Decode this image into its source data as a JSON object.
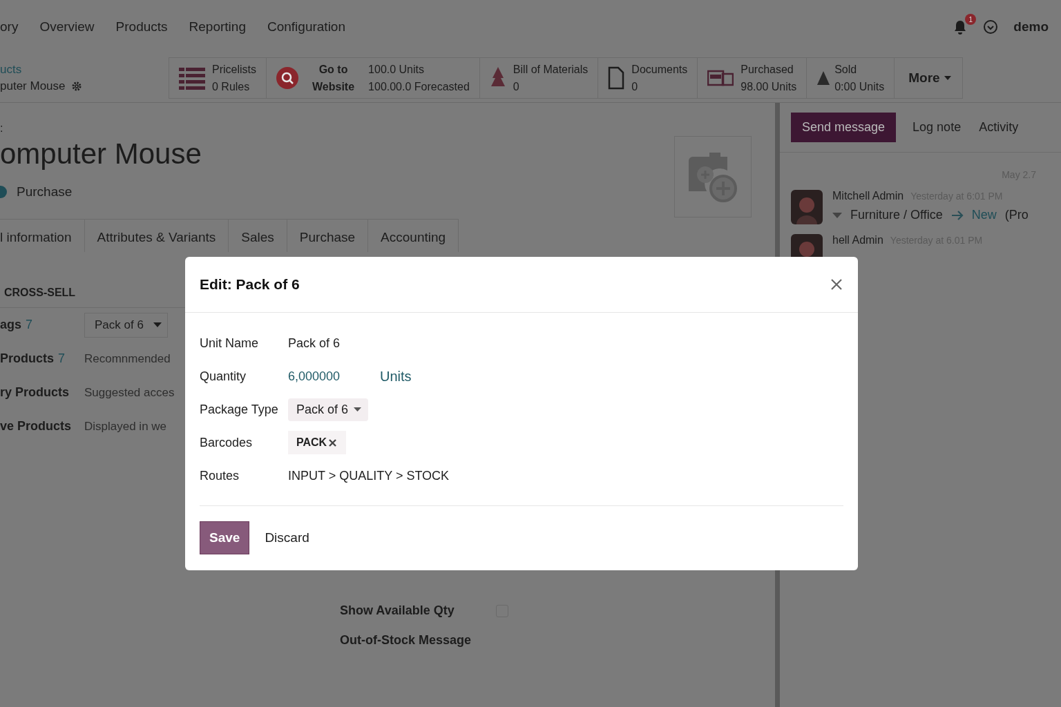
{
  "nav": {
    "menus": [
      {
        "label": "ory"
      },
      {
        "label": "Overview"
      },
      {
        "label": "Products"
      },
      {
        "label": "Reporting"
      },
      {
        "label": "Configuration"
      }
    ],
    "notification_count": "1",
    "user": "demo"
  },
  "breadcrumb": {
    "parent": "ucts",
    "current": "puter Mouse"
  },
  "smart_buttons": [
    {
      "kind": "list",
      "lines": [
        "Pricelists",
        "0 Rules"
      ]
    },
    {
      "kind": "website",
      "lines": [
        "Go to",
        "Website"
      ],
      "extra_lines": [
        "100.0 Units",
        "100.00.0 Forecasted"
      ]
    },
    {
      "kind": "tree",
      "lines": [
        "Bill of Materials",
        "0"
      ]
    },
    {
      "kind": "doc",
      "lines": [
        "Documents",
        "0"
      ]
    },
    {
      "kind": "cards",
      "lines": [
        "Purchased",
        "98.00 Units"
      ]
    },
    {
      "kind": "triangle",
      "lines": [
        "Sold",
        "0:00  Units"
      ]
    },
    {
      "kind": "more",
      "lines": [
        "More"
      ]
    }
  ],
  "product": {
    "overline": ":",
    "name": "omputer Mouse",
    "option": "Purchase"
  },
  "tabs": [
    {
      "label": "l information",
      "selected": false
    },
    {
      "label": "Attributes & Variants",
      "selected": false
    },
    {
      "label": "Sales",
      "selected": false
    },
    {
      "label": "Purchase",
      "selected": false
    },
    {
      "label": "Accounting",
      "selected": false
    }
  ],
  "section": {
    "title": "CROSS-SELL",
    "fields": [
      {
        "kind": "select",
        "label": "ags",
        "count": "7",
        "value": "Pack of 6"
      },
      {
        "kind": "text",
        "label": "Products",
        "count": "7",
        "placeholder": "Recomnmended"
      },
      {
        "kind": "text",
        "label": "ry Products",
        "placeholder": "Suggested acces"
      },
      {
        "kind": "text",
        "label": "ve Products",
        "placeholder": "Displayed in we"
      }
    ]
  },
  "lower_fields": [
    {
      "kind": "checkbox",
      "label": "Show  Available Qty",
      "checked": false
    },
    {
      "kind": "label",
      "label": "Out-of-Stock Message"
    }
  ],
  "chatter": {
    "buttons": [
      {
        "label": "Send message",
        "kind": "primary"
      },
      {
        "label": "Log note",
        "kind": "plain"
      },
      {
        "label": "Activity",
        "kind": "plain"
      }
    ],
    "date": "May 2.7",
    "messages": [
      {
        "author": "Mitchell Admin",
        "time": "Yesterday at 6:01 PM",
        "tracking": {
          "from": "Furniture / Office",
          "to": "New",
          "extra": "(Pro"
        }
      },
      {
        "author": "hell Admin",
        "time": "Yesterday at 6.01 PM"
      }
    ]
  },
  "dialog": {
    "title": "Edit: Pack of 6",
    "fields": [
      {
        "kind": "text",
        "label": "Unit Name",
        "value": "Pack of 6"
      },
      {
        "kind": "quantity",
        "label": "Quantity",
        "value": "6,000000",
        "unit": "Units"
      },
      {
        "kind": "select",
        "label": "Package Type",
        "value": "Pack of 6"
      },
      {
        "kind": "tags",
        "label": "Barcodes",
        "tags": [
          "PACK"
        ]
      },
      {
        "kind": "text",
        "label": "Routes",
        "value": "INPUT > QUALITY > STOCK"
      }
    ],
    "buttons": [
      {
        "label": "Save",
        "kind": "primary"
      },
      {
        "label": "Discard",
        "kind": "secondary"
      }
    ]
  }
}
